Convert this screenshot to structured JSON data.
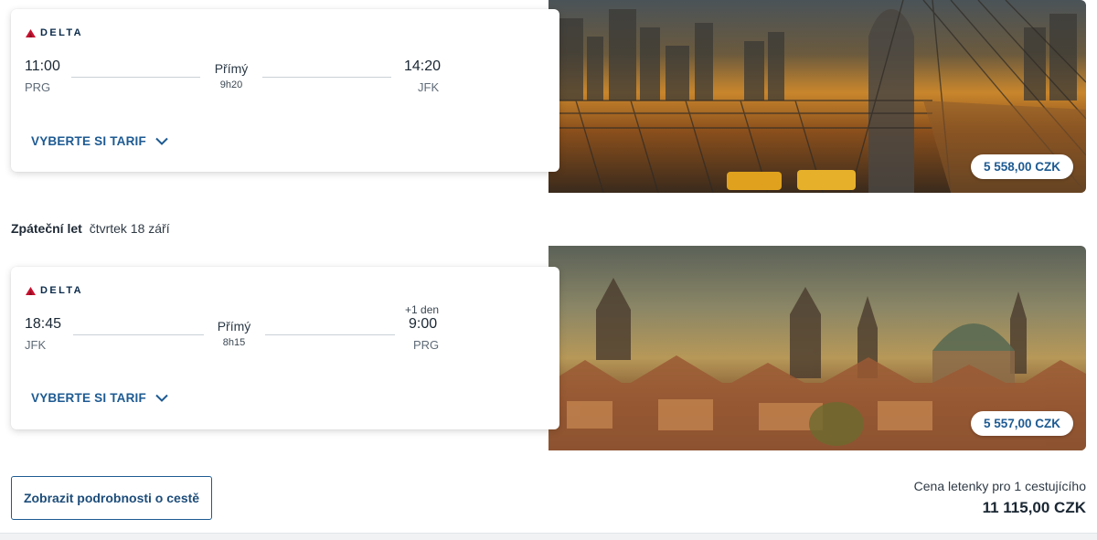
{
  "outbound": {
    "airline": "DELTA",
    "depart_time": "11:00",
    "depart_code": "PRG",
    "stops": "Přímý",
    "duration": "9h20",
    "arrive_time": "14:20",
    "arrive_code": "JFK",
    "fare_label": "VYBERTE SI TARIF",
    "price": "5 558,00 CZK",
    "image": "new-york-brooklyn-bridge"
  },
  "return_header": {
    "label": "Zpáteční let",
    "date": "čtvrtek 18 září"
  },
  "inbound": {
    "airline": "DELTA",
    "depart_time": "18:45",
    "depart_code": "JFK",
    "stops": "Přímý",
    "duration": "8h15",
    "next_day": "+1 den",
    "arrive_time": "9:00",
    "arrive_code": "PRG",
    "fare_label": "VYBERTE SI TARIF",
    "price": "5 557,00 CZK",
    "image": "prague-old-town"
  },
  "footer": {
    "details_button": "Zobrazit podrobnosti o cestě",
    "total_label": "Cena letenky pro 1 cestujícího",
    "total_price": "11 115,00 CZK"
  },
  "colors": {
    "accent": "#1d5a92",
    "delta_red": "#c8102e",
    "text": "#1a2733"
  }
}
